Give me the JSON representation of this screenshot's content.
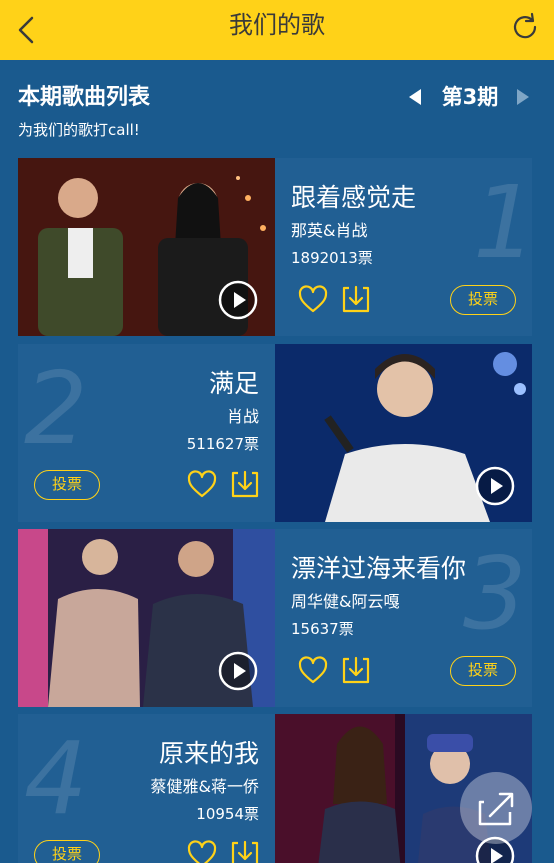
{
  "header": {
    "title": "我们的歌"
  },
  "list": {
    "title": "本期歌曲列表",
    "subtitle": "为我们的歌打call!",
    "period": "第3期"
  },
  "songs": [
    {
      "rank": "1",
      "title": "跟着感觉走",
      "artist": "那英&肖战",
      "votes": "1892013票",
      "vote_label": "投票"
    },
    {
      "rank": "2",
      "title": "满足",
      "artist": "肖战",
      "votes": "511627票",
      "vote_label": "投票"
    },
    {
      "rank": "3",
      "title": "漂洋过海来看你",
      "artist": "周华健&阿云嘎",
      "votes": "15637票",
      "vote_label": "投票"
    },
    {
      "rank": "4",
      "title": "原来的我",
      "artist": "蔡健雅&蒋一侨",
      "votes": "10954票",
      "vote_label": "投票"
    }
  ],
  "colors": {
    "accent": "#ffd218",
    "background": "#1a5a8e",
    "card": "#215f93"
  }
}
